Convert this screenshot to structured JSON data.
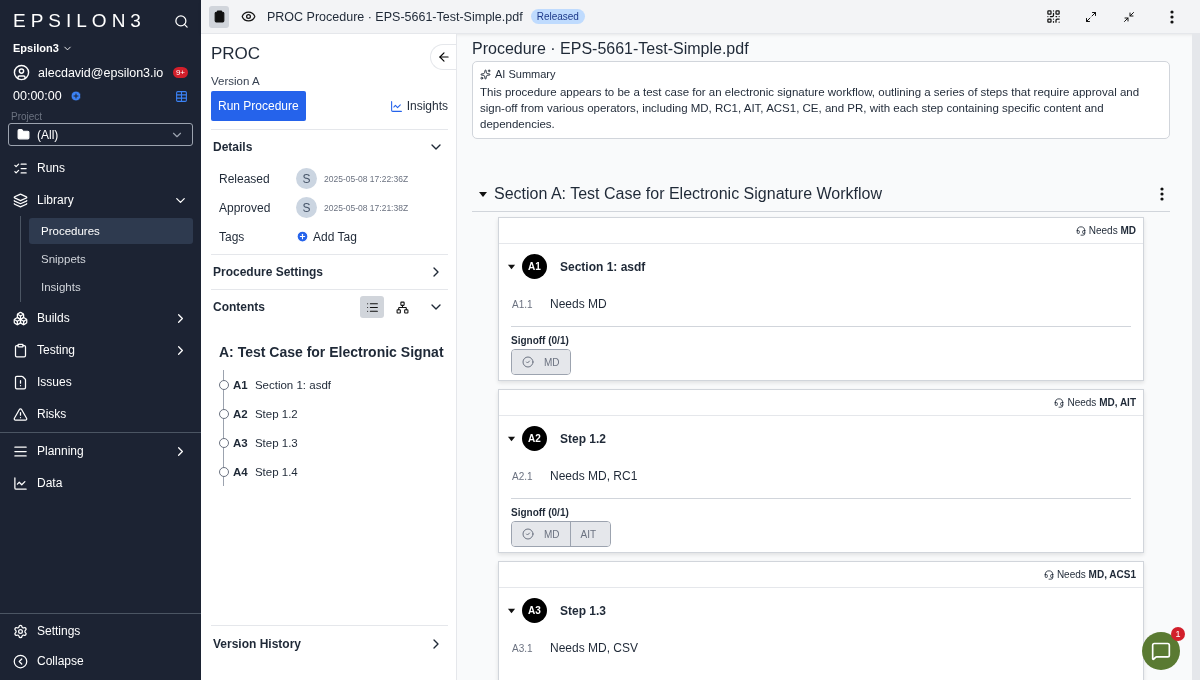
{
  "sidebar": {
    "logo": "EPSILON3",
    "workspace": "Epsilon3",
    "user": "alecdavid@epsilon3.io",
    "notifications": "9+",
    "timer": "00:00:00",
    "project_label": "Project",
    "project": "(All)",
    "nav_groups": [
      [
        {
          "label": "Runs"
        },
        {
          "label": "Library",
          "expanded": true,
          "children": [
            {
              "label": "Procedures",
              "selected": true
            },
            {
              "label": "Snippets",
              "selected": false
            },
            {
              "label": "Insights",
              "selected": false
            }
          ]
        },
        {
          "label": "Builds",
          "expanded": false
        },
        {
          "label": "Testing",
          "expanded": false
        },
        {
          "label": "Issues"
        },
        {
          "label": "Risks"
        }
      ],
      [
        {
          "label": "Planning",
          "expanded": false
        },
        {
          "label": "Data"
        }
      ]
    ],
    "footer": [
      {
        "label": "Settings"
      },
      {
        "label": "Collapse"
      }
    ]
  },
  "topbar": {
    "title": "PROC Procedure · EPS-5661-Test-Simple.pdf",
    "status": "Released"
  },
  "details_panel": {
    "code": "PROC",
    "version": "Version A",
    "run_button": "Run Procedure",
    "insights": "Insights",
    "details": {
      "title": "Details",
      "expanded": true,
      "rows": [
        {
          "label": "Released",
          "avatar": "S",
          "date": "2025-05-08 17:22:36Z"
        },
        {
          "label": "Approved",
          "avatar": "S",
          "date": "2025-05-08 17:21:38Z"
        }
      ],
      "tags_label": "Tags",
      "add_tag": "Add Tag"
    },
    "settings": {
      "title": "Procedure Settings",
      "expanded": false
    },
    "contents": {
      "title": "Contents",
      "expanded": true,
      "view_modes": [
        {
          "kind": "list",
          "selected": true
        },
        {
          "kind": "tree",
          "selected": false
        }
      ],
      "section": "A: Test Case for Electronic Signat",
      "items": [
        {
          "key": "A1",
          "label": "Section 1: asdf"
        },
        {
          "key": "A2",
          "label": "Step 1.2"
        },
        {
          "key": "A3",
          "label": "Step 1.3"
        },
        {
          "key": "A4",
          "label": "Step 1.4"
        }
      ]
    },
    "version_history": {
      "title": "Version History",
      "expanded": false
    }
  },
  "document": {
    "title": "Procedure · EPS-5661-Test-Simple.pdf",
    "summary_title": "AI Summary",
    "summary": "This procedure appears to be a test case for an electronic signature workflow, outlining a series of steps that require approval and sign-off from various operators, including MD, RC1, AIT, ACS1, CE, and PR, with each step containing specific content and dependencies.",
    "section": {
      "title": "Section A: Test Case for Electronic Signature Workflow",
      "expanded": true
    },
    "steps": [
      {
        "needs": "Needs **MD**",
        "key": "A1",
        "title": "Section 1: asdf",
        "expanded": true,
        "lines": [
          {
            "num": "A1.1",
            "text": "Needs MD"
          }
        ],
        "signoff": {
          "label": "Signoff (0/1)",
          "operators": [
            "MD"
          ]
        }
      },
      {
        "needs": "Needs **MD, AIT**",
        "key": "A2",
        "title": "Step 1.2",
        "expanded": true,
        "lines": [
          {
            "num": "A2.1",
            "text": "Needs MD, RC1"
          }
        ],
        "signoff": {
          "label": "Signoff (0/1)",
          "operators": [
            "MD",
            "AIT"
          ]
        }
      },
      {
        "needs": "Needs **MD, ACS1**",
        "key": "A3",
        "title": "Step 1.3",
        "expanded": true,
        "lines": [
          {
            "num": "A3.1",
            "text": "Needs MD, CSV"
          }
        ]
      }
    ]
  },
  "chat": {
    "badge": "1"
  }
}
